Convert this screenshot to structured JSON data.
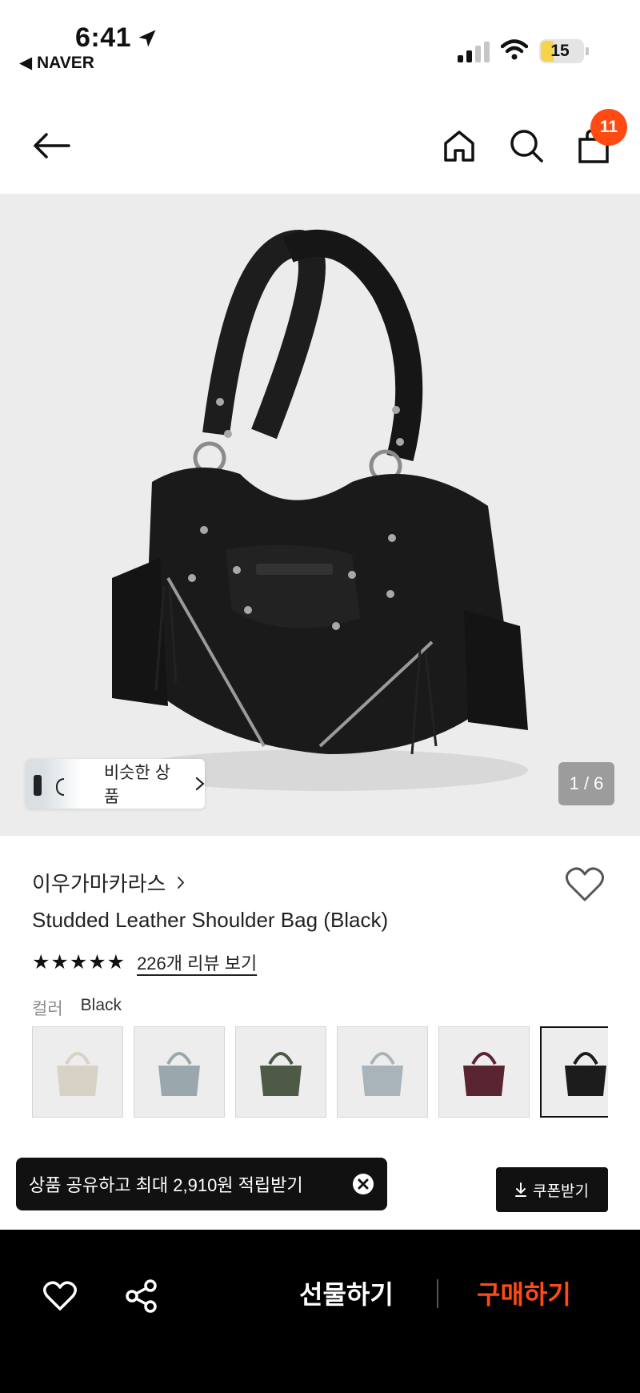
{
  "status_bar": {
    "time": "6:41",
    "back_app": "◀ NAVER",
    "battery": "15"
  },
  "nav": {
    "cart_count": "11"
  },
  "hero": {
    "similar_label": "비슷한 상품",
    "pager": "1 / 6"
  },
  "product": {
    "brand": "이우가마카라스",
    "title": "Studded Leather Shoulder Bag (Black)",
    "stars": "★★★★★",
    "reviews": "226개 리뷰 보기",
    "color_label": "컬러",
    "color_value": "Black",
    "swatches": [
      {
        "color": "#d8d2c4"
      },
      {
        "color": "#9aa7ad"
      },
      {
        "color": "#4e5a45"
      },
      {
        "color": "#a9b4ba"
      },
      {
        "color": "#5a2430"
      },
      {
        "color": "#1c1c1c"
      }
    ]
  },
  "promo": {
    "toast": "상품 공유하고 최대 2,910원 적립받기",
    "coupon": "쿠폰받기"
  },
  "bottom_bar": {
    "gift": "선물하기",
    "buy": "구매하기"
  }
}
